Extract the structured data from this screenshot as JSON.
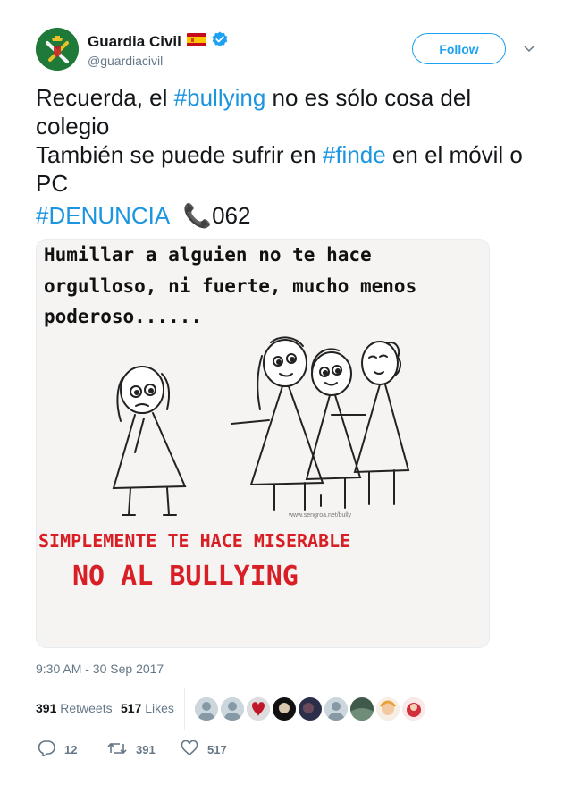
{
  "user": {
    "display_name": "Guardia Civil",
    "handle": "@guardiacivil",
    "flag_icon": "spain-flag-icon",
    "verified_icon": "verified-badge-icon",
    "follow_label": "Follow"
  },
  "tweet": {
    "line1_pre": "Recuerda, el ",
    "line1_tag": "#bullying",
    "line1_post": " no es sólo cosa del colegio",
    "line2_pre": "También se puede sufrir en ",
    "line2_tag": "#finde",
    "line2_post": " en el móvil o PC",
    "line3_tag": "#DENUNCIA",
    "line3_phone": "📞",
    "line3_number": "062"
  },
  "media": {
    "text_top_1": "Humillar a alguien no te hace",
    "text_top_2": "orgulloso, ni fuerte, mucho menos",
    "text_top_3": "poderoso......",
    "watermark": "www.sengroa.net/bully",
    "text_bottom_1": "SIMPLEMENTE TE HACE MISERABLE",
    "text_bottom_2": "NO AL BULLYING"
  },
  "timestamp": "9:30 AM - 30 Sep 2017",
  "stats": {
    "retweets_count": "391",
    "retweets_label": "Retweets",
    "likes_count": "517",
    "likes_label": "Likes"
  },
  "actions": {
    "reply_count": "12",
    "retweet_count": "391",
    "like_count": "517"
  },
  "colors": {
    "link": "#1b95e0",
    "accent": "#1da1f2",
    "muted": "#657786",
    "image_red": "#d81f26"
  }
}
